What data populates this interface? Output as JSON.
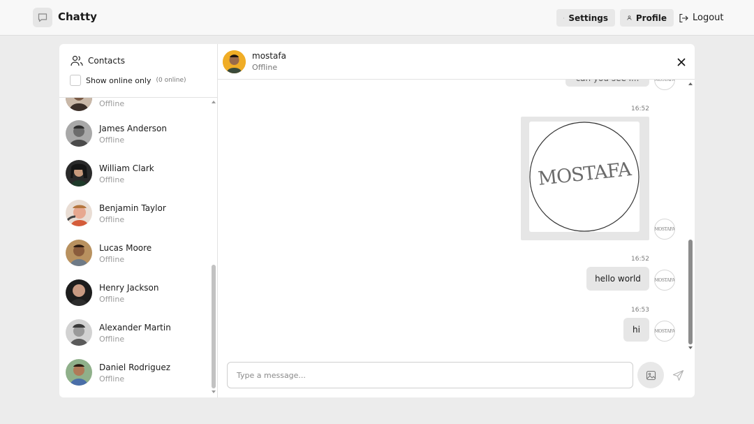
{
  "navbar": {
    "brand": "Chatty",
    "settings_label": "Settings",
    "profile_label": "Profile",
    "logout_label": "Logout"
  },
  "sidebar": {
    "title": "Contacts",
    "online_only_label": "Show online only",
    "online_count": "(0 online)",
    "contacts": [
      {
        "name": "",
        "status": "Offline"
      },
      {
        "name": "James Anderson",
        "status": "Offline"
      },
      {
        "name": "William Clark",
        "status": "Offline"
      },
      {
        "name": "Benjamin Taylor",
        "status": "Offline"
      },
      {
        "name": "Lucas Moore",
        "status": "Offline"
      },
      {
        "name": "Henry Jackson",
        "status": "Offline"
      },
      {
        "name": "Alexander Martin",
        "status": "Offline"
      },
      {
        "name": "Daniel Rodriguez",
        "status": "Offline"
      }
    ]
  },
  "chat": {
    "name": "mostafa",
    "status": "Offline",
    "partial_message": "can you see i...",
    "messages": [
      {
        "time": "16:52",
        "type": "image",
        "image_text": "MOSTAFA"
      },
      {
        "time": "16:52",
        "type": "text",
        "text": "hello world"
      },
      {
        "time": "16:53",
        "type": "text",
        "text": "hi"
      }
    ],
    "mini_logo": "MOSTAFA"
  },
  "composer": {
    "placeholder": "Type a message..."
  }
}
